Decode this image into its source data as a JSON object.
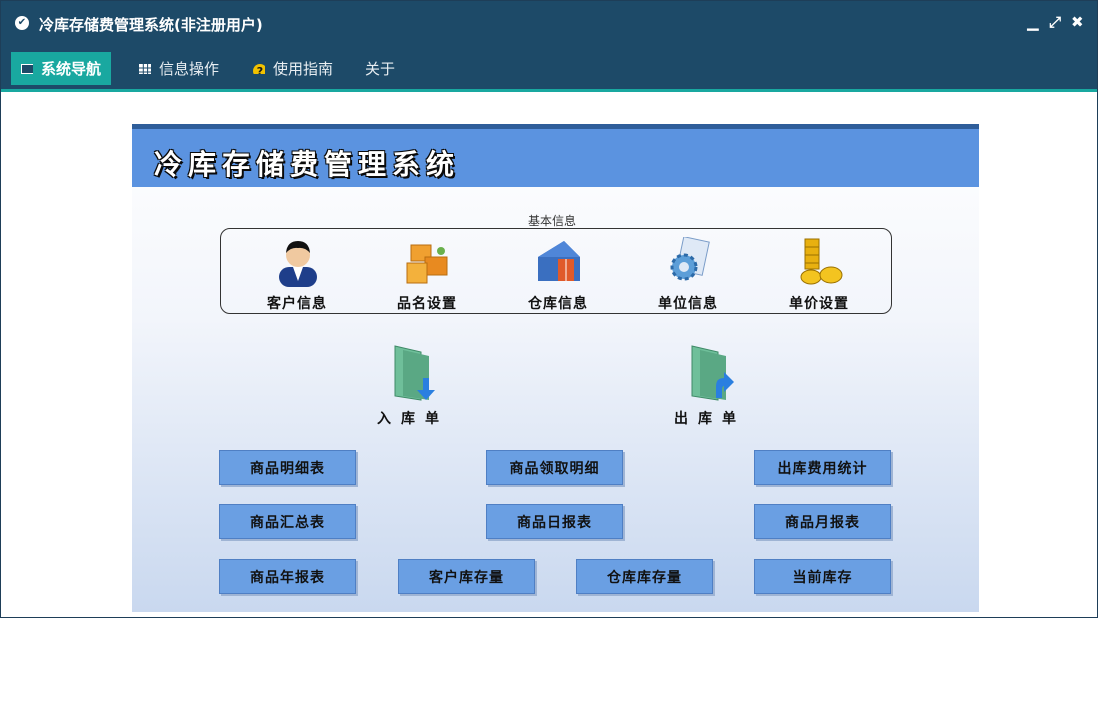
{
  "window": {
    "title": "冷库存储费管理系统(非注册用户)"
  },
  "menu": {
    "tabs": [
      {
        "label": "系统导航",
        "icon": "monitor-icon"
      },
      {
        "label": "信息操作",
        "icon": "grid-icon"
      },
      {
        "label": "使用指南",
        "icon": "help-icon"
      },
      {
        "label": "关于"
      }
    ]
  },
  "banner": {
    "title": "冷库存储费管理系统"
  },
  "basic_info": {
    "caption": "基本信息",
    "items": [
      {
        "label": "客户信息",
        "icon": "person-icon"
      },
      {
        "label": "品名设置",
        "icon": "boxes-icon"
      },
      {
        "label": "仓库信息",
        "icon": "warehouse-icon"
      },
      {
        "label": "单位信息",
        "icon": "gear-document-icon"
      },
      {
        "label": "单价设置",
        "icon": "coins-icon"
      }
    ]
  },
  "inbound": {
    "label": "入库单"
  },
  "outbound": {
    "label": "出库单"
  },
  "buttons": [
    "商品明细表",
    "商品领取明细",
    "出库费用统计",
    "商品汇总表",
    "商品日报表",
    "商品月报表",
    "商品年报表",
    "客户库存量",
    "仓库库存量",
    "当前库存"
  ],
  "colors": {
    "titlebar": "#1d4a68",
    "accent": "#19a8a0",
    "banner": "#5b93e0",
    "button": "#6a9fe3"
  }
}
